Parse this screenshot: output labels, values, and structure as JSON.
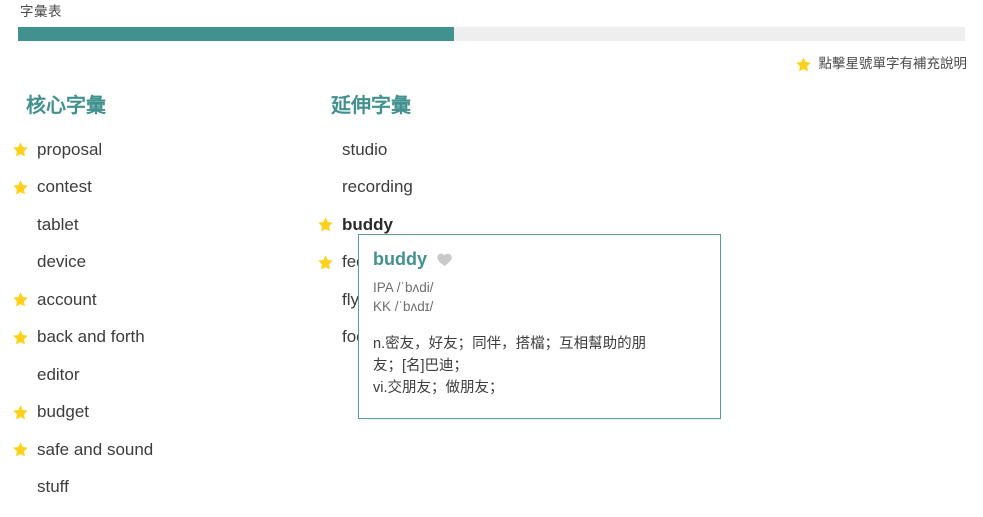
{
  "header": {
    "title": "字彙表"
  },
  "progress": {
    "percent": 46,
    "fill_color": "#41918e",
    "track_color": "#eeeeee"
  },
  "legend": {
    "icon": "star-icon",
    "text": "點擊星號單字有補充說明"
  },
  "colors": {
    "accent": "#41918e",
    "star": "#ffd11a",
    "heart": "#c9c9c9",
    "text": "#3c3c3c"
  },
  "columns": {
    "core": {
      "heading": "核心字彙",
      "words": [
        {
          "label": "proposal",
          "starred": true
        },
        {
          "label": "contest",
          "starred": true
        },
        {
          "label": "tablet",
          "starred": false
        },
        {
          "label": "device",
          "starred": false
        },
        {
          "label": "account",
          "starred": true
        },
        {
          "label": "back and forth",
          "starred": true
        },
        {
          "label": "editor",
          "starred": false
        },
        {
          "label": "budget",
          "starred": true
        },
        {
          "label": "safe and sound",
          "starred": true
        },
        {
          "label": "stuff",
          "starred": false
        }
      ]
    },
    "extended": {
      "heading": "延伸字彙",
      "words": [
        {
          "label": "studio",
          "starred": false
        },
        {
          "label": "recording",
          "starred": false
        },
        {
          "label": "buddy",
          "starred": true
        },
        {
          "label": "feed",
          "starred": true
        },
        {
          "label": "flyer",
          "starred": false
        },
        {
          "label": "food",
          "starred": false
        }
      ]
    }
  },
  "popup": {
    "word": "buddy",
    "favorite_icon": "heart-icon",
    "phonetics": [
      "IPA /ˈbʌdi/",
      "KK /ˈbʌdɪ/"
    ],
    "definitions": [
      "n.密友，好友；同伴，搭檔；互相幫助的朋",
      "友；[名]巴迪；",
      "vi.交朋友；做朋友；"
    ]
  }
}
